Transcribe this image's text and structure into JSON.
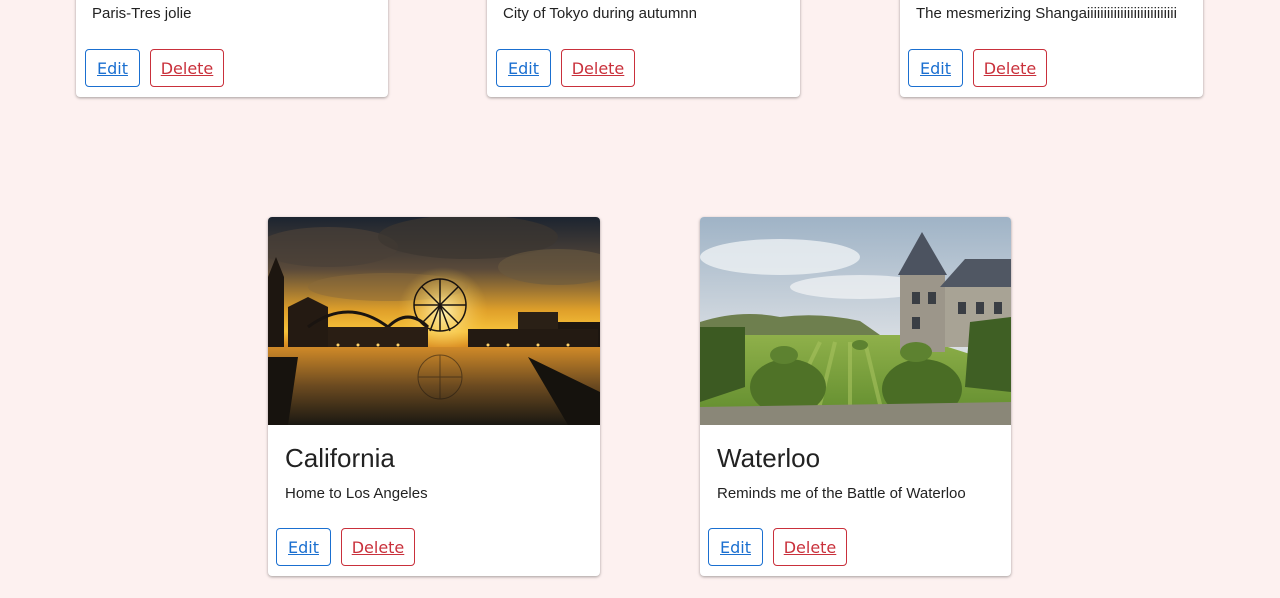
{
  "cards_top": [
    {
      "description": "Paris-Tres jolie",
      "edit_label": "Edit",
      "delete_label": "Delete"
    },
    {
      "description": "City of Tokyo during autumnn",
      "edit_label": "Edit",
      "delete_label": "Delete"
    },
    {
      "description": "The mesmerizing Shangaiiiiiiiiiiiiiiiiiiiiiiiiiii",
      "edit_label": "Edit",
      "delete_label": "Delete"
    }
  ],
  "cards_bottom": [
    {
      "title": "California",
      "description": "Home to Los Angeles",
      "image": "california-pier-sunset-image",
      "edit_label": "Edit",
      "delete_label": "Delete"
    },
    {
      "title": "Waterloo",
      "description": "Reminds me of the Battle of Waterloo",
      "image": "waterloo-chateau-garden-image",
      "edit_label": "Edit",
      "delete_label": "Delete"
    }
  ],
  "colors": {
    "background": "#fdf1f0",
    "edit": "#1a6fd0",
    "delete": "#c9303b"
  }
}
